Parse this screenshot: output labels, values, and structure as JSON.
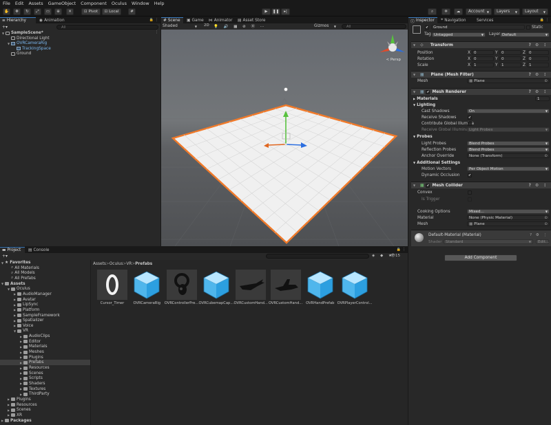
{
  "menu": [
    "File",
    "Edit",
    "Assets",
    "GameObject",
    "Component",
    "Oculus",
    "Window",
    "Help"
  ],
  "toolbar": {
    "pivot": "Pivot",
    "local": "Local",
    "account": "Account",
    "layers": "Layers",
    "layout": "Layout"
  },
  "hierarchy": {
    "tabs": [
      "Hierarchy",
      "Animation"
    ],
    "search_placeholder": "All",
    "items": [
      {
        "label": "SampleScene*",
        "depth": 0,
        "prefab": false
      },
      {
        "label": "Directional Light",
        "depth": 1,
        "prefab": false
      },
      {
        "label": "OVRCameraRig",
        "depth": 1,
        "prefab": true
      },
      {
        "label": "TrackingSpace",
        "depth": 2,
        "prefab": true
      },
      {
        "label": "Ground",
        "depth": 1,
        "prefab": false
      }
    ]
  },
  "scene": {
    "tabs": [
      "Scene",
      "Game",
      "Animator",
      "Asset Store"
    ],
    "shading": "Shaded",
    "mode_2d": "2D",
    "gizmos": "Gizmos",
    "search_placeholder": "All",
    "persp": "< Persp"
  },
  "inspector": {
    "tabs": [
      "Inspector",
      "Navigation",
      "Services"
    ],
    "object_name": "Ground",
    "static_label": "Static",
    "tag_label": "Tag",
    "tag_value": "Untagged",
    "layer_label": "Layer",
    "layer_value": "Default",
    "transform": {
      "title": "Transform",
      "rows": [
        {
          "label": "Position",
          "x": "0",
          "y": "0",
          "z": "0"
        },
        {
          "label": "Rotation",
          "x": "0",
          "y": "0",
          "z": "0"
        },
        {
          "label": "Scale",
          "x": "1",
          "y": "1",
          "z": "1"
        }
      ],
      "axis_labels": [
        "X",
        "Y",
        "Z"
      ]
    },
    "mesh_filter": {
      "title": "Plane (Mesh Filter)",
      "mesh_label": "Mesh",
      "mesh_value": "Plane"
    },
    "mesh_renderer": {
      "title": "Mesh Renderer",
      "materials_label": "Materials",
      "materials_count": "1",
      "lighting_label": "Lighting",
      "cast_shadows_label": "Cast Shadows",
      "cast_shadows_value": "On",
      "receive_shadows_label": "Receive Shadows",
      "contribute_gi_label": "Contribute Global Illumina",
      "receive_gi_label": "Receive Global Illuminati",
      "receive_gi_value": "Light Probes",
      "probes_label": "Probes",
      "light_probes_label": "Light Probes",
      "light_probes_value": "Blend Probes",
      "reflection_probes_label": "Reflection Probes",
      "reflection_probes_value": "Blend Probes",
      "anchor_override_label": "Anchor Override",
      "anchor_override_value": "None (Transform)",
      "additional_label": "Additional Settings",
      "motion_vectors_label": "Motion Vectors",
      "motion_vectors_value": "Per Object Motion",
      "dynamic_occlusion_label": "Dynamic Occlusion"
    },
    "mesh_collider": {
      "title": "Mesh Collider",
      "convex_label": "Convex",
      "is_trigger_label": "Is Trigger",
      "cooking_label": "Cooking Options",
      "cooking_value": "Mixed...",
      "material_label": "Material",
      "material_value": "None (Physic Material)",
      "mesh_label": "Mesh",
      "mesh_value": "Plane"
    },
    "material": {
      "title": "Default-Material (Material)",
      "shader_label": "Shader",
      "shader_value": "Standard",
      "edit_label": "Edit..."
    },
    "add_component": "Add Component"
  },
  "project": {
    "tabs": [
      "Project",
      "Console"
    ],
    "breadcrumb": [
      "Assets",
      "Oculus",
      "VR",
      "Prefabs"
    ],
    "count": "15",
    "tree": [
      {
        "label": "Favorites",
        "depth": 0,
        "bold": true,
        "kind": "star"
      },
      {
        "label": "All Materials",
        "depth": 1,
        "kind": "search"
      },
      {
        "label": "All Models",
        "depth": 1,
        "kind": "search"
      },
      {
        "label": "All Prefabs",
        "depth": 1,
        "kind": "search"
      },
      {
        "label": "Assets",
        "depth": 0,
        "bold": true,
        "kind": "folder"
      },
      {
        "label": "Oculus",
        "depth": 1,
        "kind": "folder"
      },
      {
        "label": "AudioManager",
        "depth": 2,
        "kind": "folder"
      },
      {
        "label": "Avatar",
        "depth": 2,
        "kind": "folder"
      },
      {
        "label": "LipSync",
        "depth": 2,
        "kind": "folder"
      },
      {
        "label": "Platform",
        "depth": 2,
        "kind": "folder"
      },
      {
        "label": "SampleFramework",
        "depth": 2,
        "kind": "folder"
      },
      {
        "label": "Spatializer",
        "depth": 2,
        "kind": "folder"
      },
      {
        "label": "Voice",
        "depth": 2,
        "kind": "folder"
      },
      {
        "label": "VR",
        "depth": 2,
        "kind": "folder"
      },
      {
        "label": "AudioClips",
        "depth": 3,
        "kind": "folder"
      },
      {
        "label": "Editor",
        "depth": 3,
        "kind": "folder"
      },
      {
        "label": "Materials",
        "depth": 3,
        "kind": "folder"
      },
      {
        "label": "Meshes",
        "depth": 3,
        "kind": "folder"
      },
      {
        "label": "Plugins",
        "depth": 3,
        "kind": "folder"
      },
      {
        "label": "Prefabs",
        "depth": 3,
        "kind": "folder",
        "selected": true
      },
      {
        "label": "Resources",
        "depth": 3,
        "kind": "folder"
      },
      {
        "label": "Scenes",
        "depth": 3,
        "kind": "folder"
      },
      {
        "label": "Scripts",
        "depth": 3,
        "kind": "folder"
      },
      {
        "label": "Shaders",
        "depth": 3,
        "kind": "folder"
      },
      {
        "label": "Textures",
        "depth": 3,
        "kind": "folder"
      },
      {
        "label": "ThirdParty",
        "depth": 3,
        "kind": "folder"
      },
      {
        "label": "Plugins",
        "depth": 1,
        "kind": "folder"
      },
      {
        "label": "Resources",
        "depth": 1,
        "kind": "folder"
      },
      {
        "label": "Scenes",
        "depth": 1,
        "kind": "folder"
      },
      {
        "label": "XR",
        "depth": 1,
        "kind": "folder"
      },
      {
        "label": "Packages",
        "depth": 0,
        "bold": true,
        "kind": "folder"
      }
    ],
    "assets": [
      {
        "name": "Cursor_Timer",
        "kind": "ring"
      },
      {
        "name": "OVRCameraRig",
        "kind": "cube"
      },
      {
        "name": "OVRControllerPre...",
        "kind": "controller"
      },
      {
        "name": "OVRCubemapCap...",
        "kind": "cube"
      },
      {
        "name": "OVRCustomHand...",
        "kind": "hand"
      },
      {
        "name": "OVRCustomHand...",
        "kind": "hand2"
      },
      {
        "name": "OVRHandPrefab",
        "kind": "cube"
      },
      {
        "name": "OVRPlayerControl...",
        "kind": "cube"
      }
    ]
  }
}
